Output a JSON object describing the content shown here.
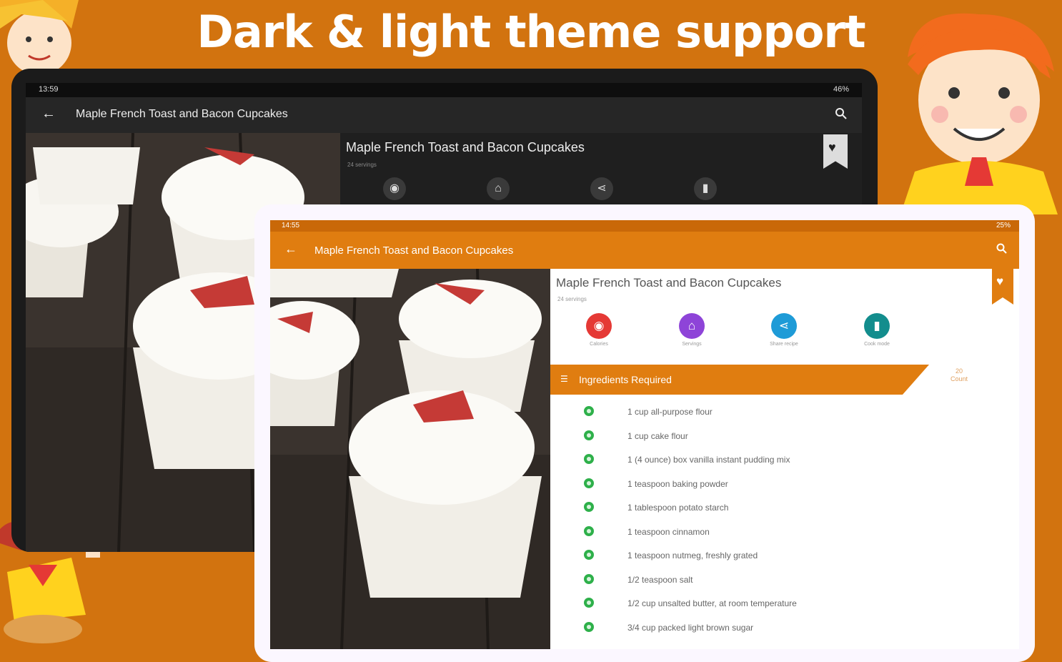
{
  "headline": "Dark & light theme support",
  "recipe_title": "Maple French Toast and Bacon Cupcakes",
  "dark": {
    "status_time": "13:59",
    "status_right": "46%",
    "appbar_title": "Maple French Toast and Bacon Cupcakes",
    "detail_title": "Maple French Toast and Bacon Cupcakes",
    "detail_sub": "24 servings"
  },
  "light": {
    "status_time": "14:55",
    "status_right": "25%",
    "appbar_title": "Maple French Toast and Bacon Cupcakes",
    "detail_title": "Maple French Toast and Bacon Cupcakes",
    "detail_sub": "24 servings",
    "actions": [
      {
        "label": "Calories",
        "color": "#e53935",
        "icon": "fire-icon"
      },
      {
        "label": "Servings",
        "color": "#8e44d8",
        "icon": "dish-icon"
      },
      {
        "label": "Share recipe",
        "color": "#1e9bd7",
        "icon": "share-icon"
      },
      {
        "label": "Cook mode",
        "color": "#138d8d",
        "icon": "book-icon"
      }
    ],
    "ingredients_label": "Ingredients Required",
    "ingredients_count_num": "20",
    "ingredients_count_word": "Count",
    "ingredients": [
      "1 cup all-purpose flour",
      "1 cup cake flour",
      "1 (4 ounce) box vanilla instant pudding mix",
      "1 teaspoon baking powder",
      "1 tablespoon potato starch",
      "1 teaspoon cinnamon",
      "1 teaspoon nutmeg, freshly grated",
      "1/2 teaspoon salt",
      "1/2 cup unsalted butter, at room temperature",
      "3/4 cup packed light brown sugar"
    ]
  },
  "colors": {
    "background": "#d2730f",
    "accent": "#e07d10",
    "dark_surface": "#202020",
    "bullet": "#2eb04a"
  }
}
